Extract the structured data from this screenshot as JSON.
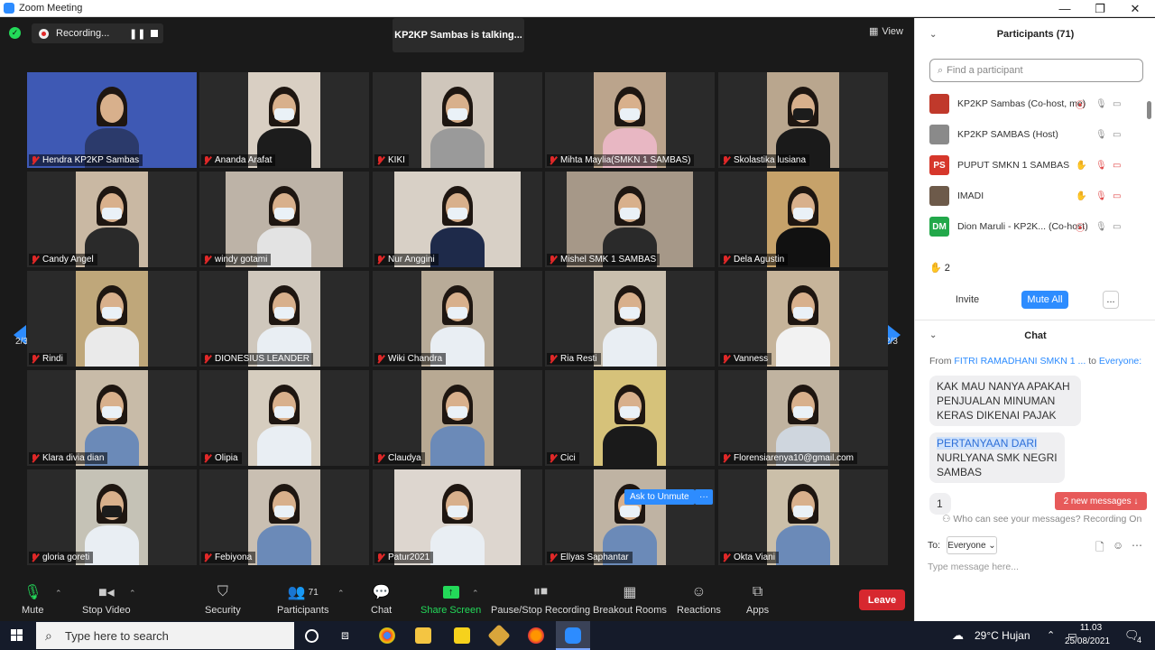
{
  "window": {
    "title": "Zoom Meeting",
    "minimize": "—",
    "restore": "❐",
    "close": "✕"
  },
  "top": {
    "recording_label": "Recording...",
    "talking": "KP2KP Sambas is talking...",
    "view_label": "View"
  },
  "page": {
    "left": "2/3",
    "right": "2/3"
  },
  "tiles": [
    {
      "name": "Hendra KP2KP Sambas"
    },
    {
      "name": "Ananda Arafat"
    },
    {
      "name": "KIKI"
    },
    {
      "name": "Mihta Maylia(SMKN 1 SAMBAS)"
    },
    {
      "name": "Skolastika lusiana"
    },
    {
      "name": "Candy Angel"
    },
    {
      "name": "windy gotami"
    },
    {
      "name": "Nur Anggini"
    },
    {
      "name": "Mishel SMK 1 SAMBAS"
    },
    {
      "name": "Dela Agustin"
    },
    {
      "name": "Rindi"
    },
    {
      "name": "DIONESIUS LEANDER"
    },
    {
      "name": "Wiki Chandra"
    },
    {
      "name": "Ria Resti"
    },
    {
      "name": "Vanness"
    },
    {
      "name": "Klara divia dian"
    },
    {
      "name": "Olipia"
    },
    {
      "name": "Claudya"
    },
    {
      "name": "Cici"
    },
    {
      "name": "Florensiarenya10@gmail.com"
    },
    {
      "name": "gloria goreti"
    },
    {
      "name": "Febiyona"
    },
    {
      "name": "Patur2021"
    },
    {
      "name": "Ellyas Saphantar"
    },
    {
      "name": "Okta Viani"
    }
  ],
  "ask_unmute": "Ask to Unmute",
  "ask_more": "···",
  "toolbar": {
    "mute": "Mute",
    "stop_video": "Stop Video",
    "security": "Security",
    "participants": "Participants",
    "participants_count": "71",
    "chat": "Chat",
    "share": "Share Screen",
    "record": "Pause/Stop Recording",
    "breakout": "Breakout Rooms",
    "reactions": "Reactions",
    "apps": "Apps",
    "leave": "Leave"
  },
  "participants_panel": {
    "title": "Participants (71)",
    "search_placeholder": "Find a participant",
    "rows": [
      {
        "name": "KP2KP Sambas (Co-host, me)",
        "avatar": "",
        "color": "#c0392b"
      },
      {
        "name": "KP2KP SAMBAS (Host)",
        "avatar": "",
        "color": "#8a8a8a"
      },
      {
        "name": "PUPUT SMKN 1 SAMBAS",
        "avatar": "PS",
        "color": "#d6372b"
      },
      {
        "name": "IMADI",
        "avatar": "",
        "color": "#6d5a4a"
      },
      {
        "name": "Dion Maruli - KP2K... (Co-host)",
        "avatar": "DM",
        "color": "#22a84a"
      }
    ],
    "raised_hands": "2",
    "invite": "Invite",
    "mute_all": "Mute All",
    "more": "..."
  },
  "chat": {
    "title": "Chat",
    "from_label": "From",
    "from_name": "FITRI RAMADHANI SMKN 1 ...",
    "to_label": "to",
    "to_name": "Everyone:",
    "msg1": "KAK MAU NANYA APAKAH PENJUALAN MINUMAN KERAS DIKENAI PAJAK",
    "msg2_highlight": "PERTANYAAN DARI",
    "msg2_rest": "NURLYANA SMK NEGRI SAMBAS",
    "msg3": "1",
    "new_messages": "2 new messages",
    "who_can_see": "Who can see your messages? Recording On",
    "to": "To:",
    "everyone": "Everyone",
    "placeholder": "Type message here..."
  },
  "taskbar": {
    "search": "Type here to search",
    "weather": "29°C  Hujan",
    "time": "11.03",
    "date": "25/08/2021",
    "notif": "4"
  }
}
